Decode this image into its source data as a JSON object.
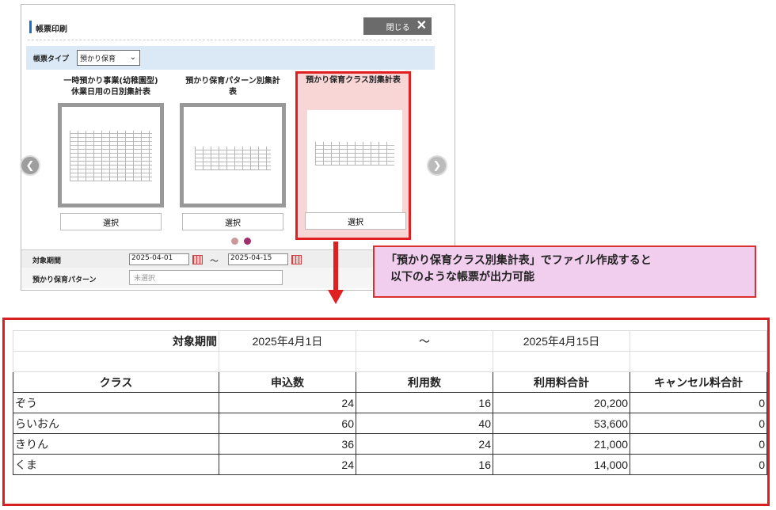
{
  "dialog": {
    "title": "帳票印刷",
    "close_label": "閉じる",
    "type_label": "帳票タイプ",
    "type_value": "預かり保育",
    "cards": [
      {
        "caption_line1": "一時預かり事業(幼稚園型)",
        "caption_line2": "休業日用の日別集計表",
        "select_label": "選択"
      },
      {
        "caption_line1": "預かり保育パターン別集計",
        "caption_line2": "表",
        "select_label": "選択"
      },
      {
        "caption_line1": "預かり保育クラス別集計表",
        "caption_line2": "",
        "select_label": "選択"
      }
    ],
    "period_label": "対象期間",
    "period_from": "2025-04-01",
    "period_tilde": "～",
    "period_to": "2025-04-15",
    "pattern_label": "預かり保育パターン",
    "pattern_placeholder": "未選択"
  },
  "callout": {
    "line1": "「預かり保育クラス別集計表」でファイル作成すると",
    "line2": "以下のような帳票が出力可能"
  },
  "report": {
    "period_label": "対象期間",
    "period_from": "2025年4月1日",
    "tilde": "～",
    "period_to": "2025年4月15日",
    "headers": [
      "クラス",
      "申込数",
      "利用数",
      "利用料合計",
      "キャンセル料合計"
    ],
    "rows": [
      [
        "ぞう",
        "24",
        "16",
        "20,200",
        "0"
      ],
      [
        "らいおん",
        "60",
        "40",
        "53,600",
        "0"
      ],
      [
        "きりん",
        "36",
        "24",
        "21,000",
        "0"
      ],
      [
        "くま",
        "24",
        "16",
        "14,000",
        "0"
      ]
    ]
  },
  "colors": {
    "accent_red": "#e02020",
    "callout_bg": "#f1cdee",
    "type_row_bg": "#dbe9f7",
    "title_bar": "#1a73c9"
  },
  "icons": {
    "prev": "chevron-left-circle-icon",
    "next": "chevron-right-circle-icon",
    "close": "close-x-icon",
    "calendar": "calendar-icon"
  }
}
